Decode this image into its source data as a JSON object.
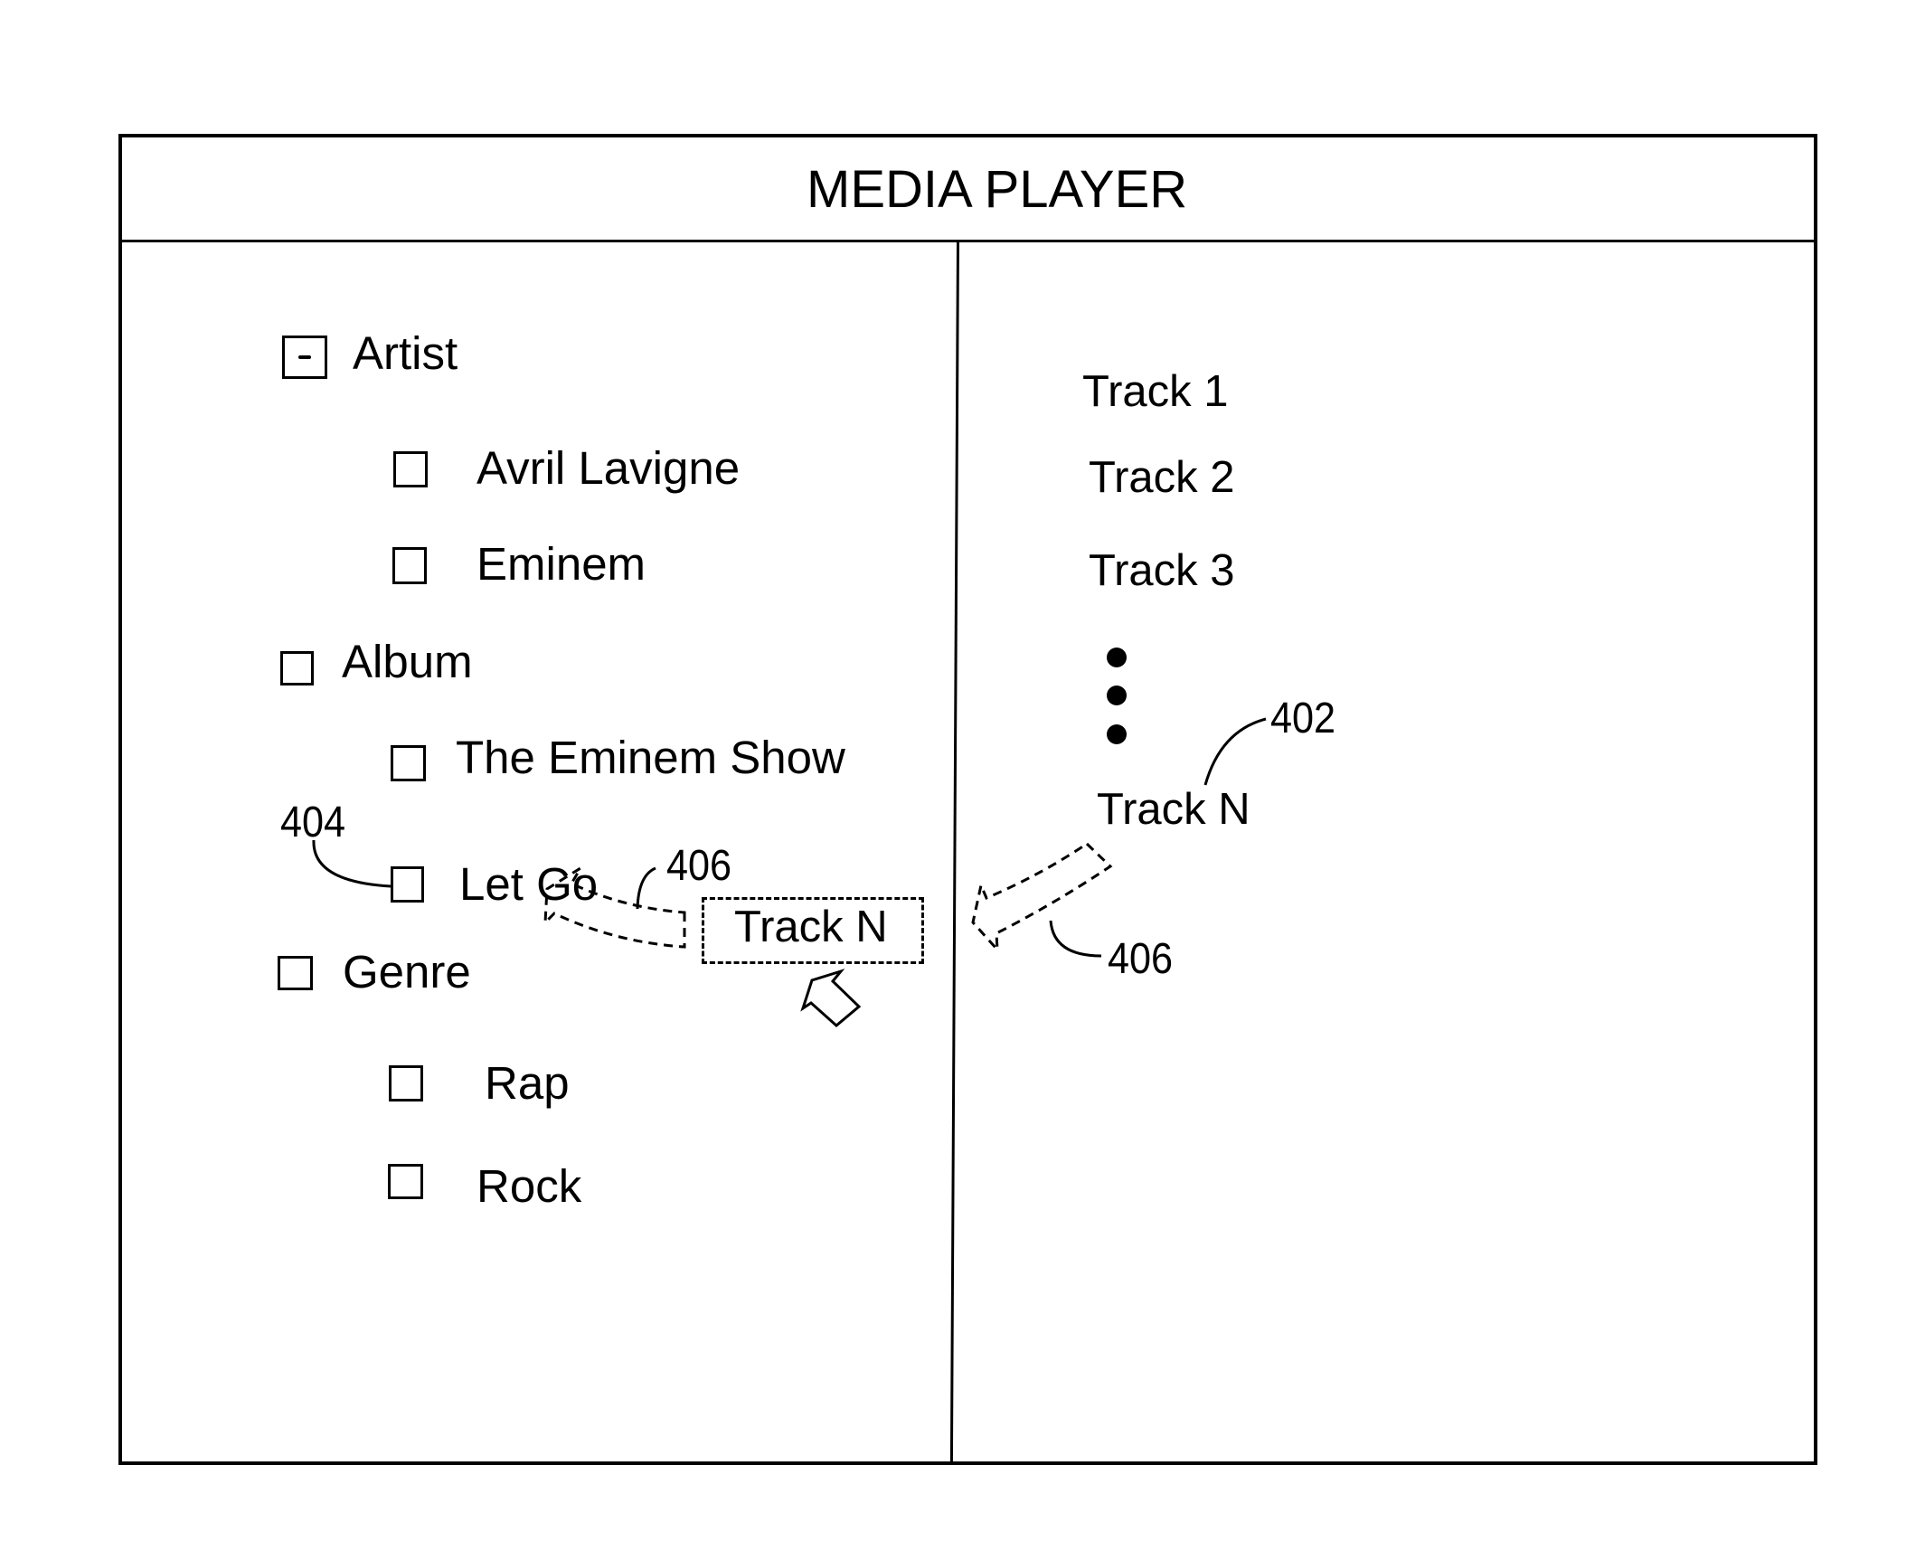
{
  "window": {
    "title": "MEDIA PLAYER"
  },
  "library_tree": {
    "categories": [
      {
        "label": "Artist",
        "expanded": true,
        "toggle_symbol": "-",
        "children": [
          {
            "label": "Avril Lavigne"
          },
          {
            "label": "Eminem"
          }
        ]
      },
      {
        "label": "Album",
        "expanded": false,
        "children": [
          {
            "label": "The Eminem Show"
          },
          {
            "label": "Let Go"
          }
        ]
      },
      {
        "label": "Genre",
        "expanded": false,
        "children": [
          {
            "label": "Rap"
          },
          {
            "label": "Rock"
          }
        ]
      }
    ]
  },
  "track_list": {
    "tracks": [
      "Track 1",
      "Track 2",
      "Track 3"
    ],
    "ellipsis": "more-tracks-dots",
    "last_track": "Track N"
  },
  "drag_operation": {
    "dragged_item_label": "Track N",
    "drop_target": "Let Go",
    "cursor_icon": "pointer-arrow-icon"
  },
  "reference_numerals": {
    "track_ref": "402",
    "checkbox_ref": "404",
    "drag_path_ref_left": "406",
    "drag_path_ref_right": "406"
  }
}
